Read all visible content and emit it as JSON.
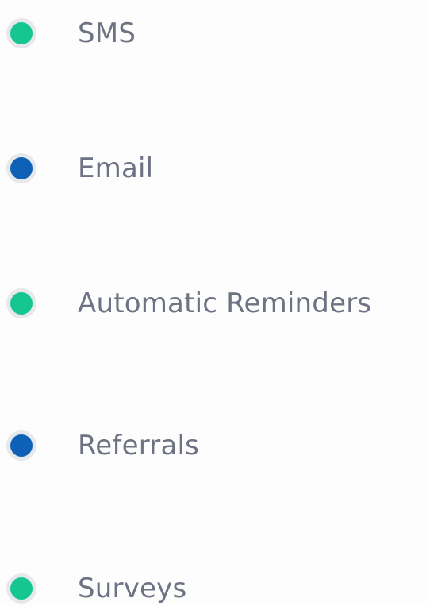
{
  "legend": {
    "items": [
      {
        "label": "SMS",
        "color": "#16c692"
      },
      {
        "label": "Email",
        "color": "#0f61b7"
      },
      {
        "label": "Automatic Reminders",
        "color": "#16c692"
      },
      {
        "label": "Referrals",
        "color": "#0f61b7"
      },
      {
        "label": "Surveys",
        "color": "#16c692"
      }
    ]
  }
}
